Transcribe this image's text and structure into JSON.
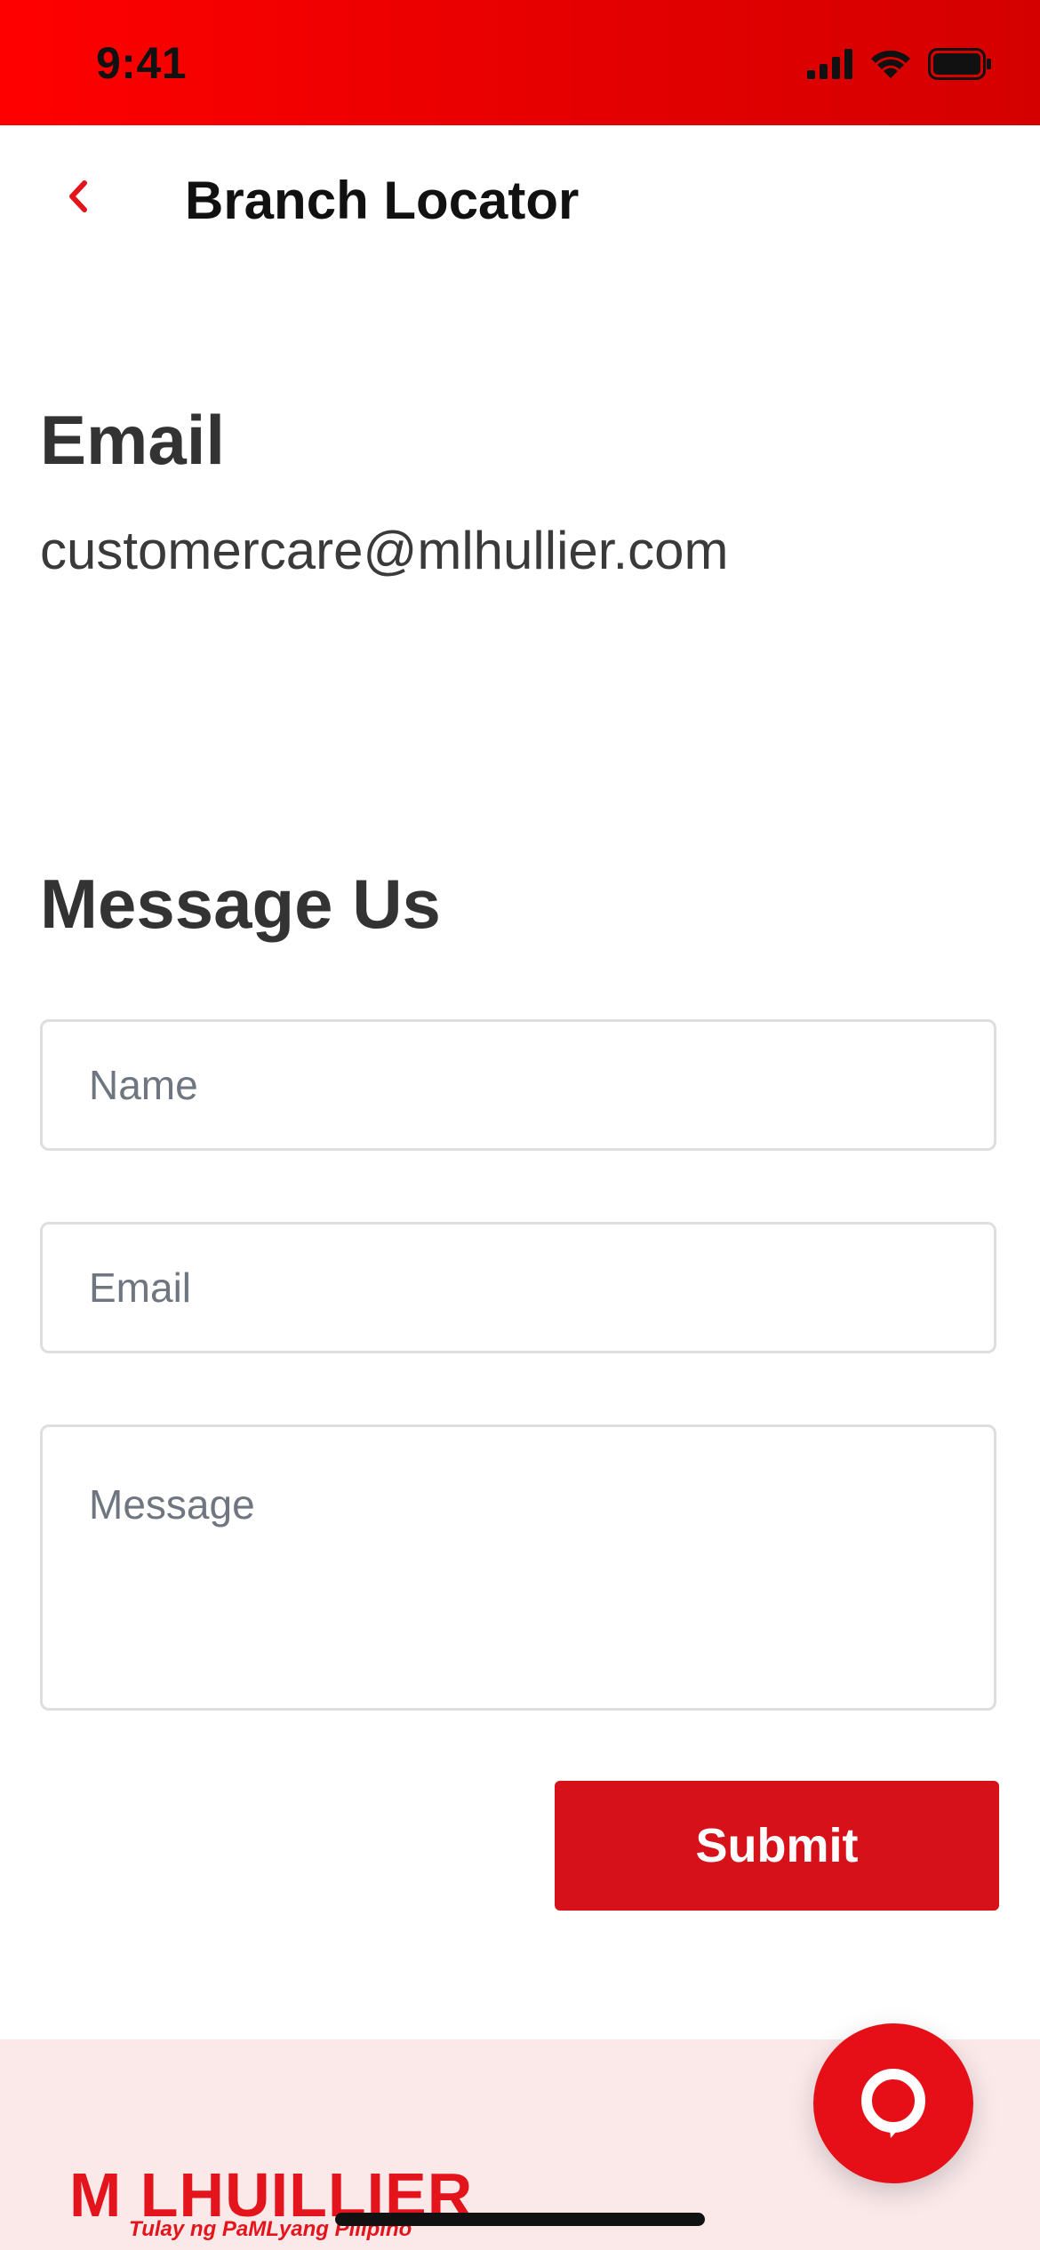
{
  "status_bar": {
    "time": "9:41"
  },
  "header": {
    "title": "Branch Locator",
    "back_icon": "chevron-left-icon"
  },
  "email_section": {
    "heading": "Email",
    "value": "customercare@mlhullier.com"
  },
  "message_section": {
    "heading": "Message Us",
    "name_placeholder": "Name",
    "email_placeholder": "Email",
    "message_placeholder": "Message",
    "submit_label": "Submit"
  },
  "footer": {
    "logo_text": "M LHUILLIER",
    "tagline": "Tulay ng PaMLyang Pilipino"
  },
  "colors": {
    "brand_red": "#e3141c",
    "button_red": "#d6111a",
    "footer_bg": "#fbe9ea"
  }
}
